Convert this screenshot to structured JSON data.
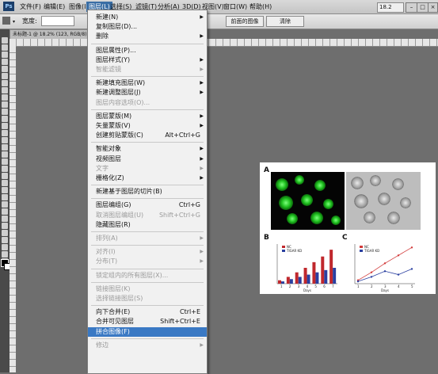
{
  "menubar": {
    "app_logo": "Ps",
    "items": [
      "文件(F)",
      "编辑(E)",
      "图像(I)",
      "图层(L)",
      "选择(S)",
      "滤镜(T)",
      "分析(A)",
      "3D(D)",
      "视图(V)",
      "窗口(W)",
      "帮助(H)"
    ],
    "active_index": 3,
    "zoom_value": "18.2"
  },
  "options_bar": {
    "width_label": "宽度:",
    "front_image_button": "前面的图像",
    "clear_button": "清除"
  },
  "document": {
    "tab_title": "未标题-1 @ 18.2% (123, RGB/8)"
  },
  "layer_menu": {
    "items": [
      {
        "label": "新建(N)",
        "shortcut": "",
        "arrow": true,
        "disabled": false
      },
      {
        "label": "复制图层(D)...",
        "shortcut": "",
        "arrow": false,
        "disabled": false
      },
      {
        "label": "删除",
        "shortcut": "",
        "arrow": true,
        "disabled": false
      },
      {
        "sep": true
      },
      {
        "label": "图层属性(P)...",
        "shortcut": "",
        "arrow": false,
        "disabled": false
      },
      {
        "label": "图层样式(Y)",
        "shortcut": "",
        "arrow": true,
        "disabled": false
      },
      {
        "label": "智能滤镜",
        "shortcut": "",
        "arrow": true,
        "disabled": true
      },
      {
        "sep": true
      },
      {
        "label": "新建填充图层(W)",
        "shortcut": "",
        "arrow": true,
        "disabled": false
      },
      {
        "label": "新建调整图层(J)",
        "shortcut": "",
        "arrow": true,
        "disabled": false
      },
      {
        "label": "图层内容选项(O)...",
        "shortcut": "",
        "arrow": false,
        "disabled": true
      },
      {
        "sep": true
      },
      {
        "label": "图层蒙版(M)",
        "shortcut": "",
        "arrow": true,
        "disabled": false
      },
      {
        "label": "矢量蒙版(V)",
        "shortcut": "",
        "arrow": true,
        "disabled": false
      },
      {
        "label": "创建剪贴蒙版(C)",
        "shortcut": "Alt+Ctrl+G",
        "arrow": false,
        "disabled": false
      },
      {
        "sep": true
      },
      {
        "label": "智能对象",
        "shortcut": "",
        "arrow": true,
        "disabled": false
      },
      {
        "label": "视频图层",
        "shortcut": "",
        "arrow": true,
        "disabled": false
      },
      {
        "label": "文字",
        "shortcut": "",
        "arrow": true,
        "disabled": true
      },
      {
        "label": "栅格化(Z)",
        "shortcut": "",
        "arrow": true,
        "disabled": false
      },
      {
        "sep": true
      },
      {
        "label": "新建基于图层的切片(B)",
        "shortcut": "",
        "arrow": false,
        "disabled": false
      },
      {
        "sep": true
      },
      {
        "label": "图层编组(G)",
        "shortcut": "Ctrl+G",
        "arrow": false,
        "disabled": false
      },
      {
        "label": "取消图层编组(U)",
        "shortcut": "Shift+Ctrl+G",
        "arrow": false,
        "disabled": true
      },
      {
        "label": "隐藏图层(R)",
        "shortcut": "",
        "arrow": false,
        "disabled": false
      },
      {
        "sep": true
      },
      {
        "label": "排列(A)",
        "shortcut": "",
        "arrow": true,
        "disabled": true
      },
      {
        "sep": true
      },
      {
        "label": "对齐(I)",
        "shortcut": "",
        "arrow": true,
        "disabled": true
      },
      {
        "label": "分布(T)",
        "shortcut": "",
        "arrow": true,
        "disabled": true
      },
      {
        "sep": true
      },
      {
        "label": "锁定组内的所有图层(X)...",
        "shortcut": "",
        "arrow": false,
        "disabled": true
      },
      {
        "sep": true
      },
      {
        "label": "链接图层(K)",
        "shortcut": "",
        "arrow": false,
        "disabled": true
      },
      {
        "label": "选择链接图层(S)",
        "shortcut": "",
        "arrow": false,
        "disabled": true
      },
      {
        "sep": true
      },
      {
        "label": "向下合并(E)",
        "shortcut": "Ctrl+E",
        "arrow": false,
        "disabled": false
      },
      {
        "label": "合并可见图层",
        "shortcut": "Shift+Ctrl+E",
        "arrow": false,
        "disabled": false
      },
      {
        "label": "拼合图像(F)",
        "shortcut": "",
        "arrow": false,
        "disabled": false,
        "highlight": true
      },
      {
        "sep": true
      },
      {
        "label": "修边",
        "shortcut": "",
        "arrow": true,
        "disabled": true
      }
    ]
  },
  "figure": {
    "panel_labels": [
      "A",
      "B",
      "C"
    ],
    "panel_b": {
      "legend": [
        "NC",
        "TIGAR KD"
      ],
      "xlabel": "Days",
      "x": [
        1,
        2,
        3,
        4,
        5,
        6,
        7
      ],
      "series": [
        {
          "name": "NC",
          "values": [
            0.3,
            0.6,
            1.0,
            1.4,
            1.9,
            2.4,
            3.0
          ],
          "color": "#c0282d"
        },
        {
          "name": "TIGAR KD",
          "values": [
            0.2,
            0.4,
            0.6,
            0.8,
            1.0,
            1.2,
            1.4
          ],
          "color": "#2a3fa0"
        }
      ]
    },
    "panel_c": {
      "legend": [
        "NC",
        "TIGAR KD"
      ],
      "xlabel": "Days",
      "x": [
        1,
        2,
        3,
        4,
        5
      ],
      "series": [
        {
          "name": "NC",
          "values": [
            0.3,
            1.0,
            1.8,
            2.5,
            3.2
          ],
          "color": "#d23a3a"
        },
        {
          "name": "TIGAR KD",
          "values": [
            0.2,
            0.6,
            1.1,
            0.8,
            1.3
          ],
          "color": "#2a3fa0"
        }
      ]
    }
  }
}
